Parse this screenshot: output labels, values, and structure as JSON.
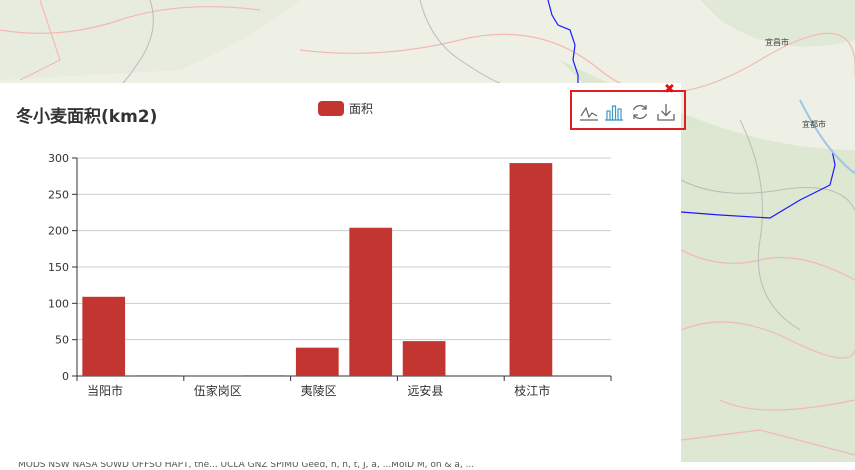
{
  "map": {
    "place_labels": [
      "宜昌市",
      "宜都市"
    ]
  },
  "chart_panel": {
    "footer_text": "MODS NSW NASA SOWD OFFSO HAPT, the... UCLA GNZ SPIMU Geed, h, h, t, J, a, ...MoID M, on & a, ..."
  },
  "toolbox": {
    "items": [
      {
        "name": "line-chart-icon",
        "active": false
      },
      {
        "name": "bar-chart-icon",
        "active": true
      },
      {
        "name": "restore-icon",
        "active": false
      },
      {
        "name": "download-icon",
        "active": false
      }
    ],
    "close_glyph": "✖"
  },
  "colors": {
    "bar": "#c23531",
    "toolbox_border": "#e02020",
    "active_icon": "#3e98c5"
  },
  "chart_data": {
    "type": "bar",
    "title": "冬小麦面积(km2)",
    "legend": [
      "面积"
    ],
    "categories": [
      "当阳市",
      "",
      "伍家岗区",
      "",
      "夷陵区",
      "",
      "远安县",
      "",
      "枝江市",
      ""
    ],
    "series": [
      {
        "name": "面积",
        "values": [
          109,
          1,
          0,
          1,
          39,
          204,
          48,
          0,
          293,
          0
        ]
      }
    ],
    "ylim": [
      0,
      300
    ],
    "yticks": [
      0,
      50,
      100,
      150,
      200,
      250,
      300
    ],
    "grid": true,
    "legend_position": "top-center"
  }
}
